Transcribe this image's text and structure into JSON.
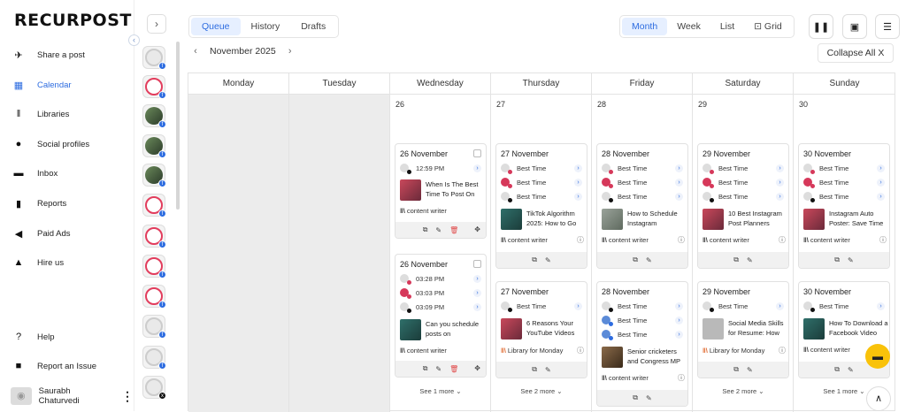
{
  "brand": {
    "logo": "RECURPOST"
  },
  "sidebar": {
    "collapse_glyph": "‹",
    "items": [
      {
        "label": "Share a post",
        "icon": "send-icon",
        "glyph": "✈"
      },
      {
        "label": "Calendar",
        "icon": "calendar-icon",
        "glyph": "▦",
        "active": true
      },
      {
        "label": "Libraries",
        "icon": "libraries-icon",
        "glyph": "‖"
      },
      {
        "label": "Social profiles",
        "icon": "profile-icon",
        "glyph": "●"
      },
      {
        "label": "Inbox",
        "icon": "inbox-icon",
        "glyph": "▬"
      },
      {
        "label": "Reports",
        "icon": "report-icon",
        "glyph": "▮"
      },
      {
        "label": "Paid Ads",
        "icon": "megaphone-icon",
        "glyph": "◀"
      },
      {
        "label": "Hire us",
        "icon": "person-icon",
        "glyph": "▲"
      },
      {
        "label": "Help",
        "icon": "help-icon",
        "glyph": "?"
      },
      {
        "label": "Report an Issue",
        "icon": "flag-icon",
        "glyph": "■"
      }
    ],
    "user": {
      "name": "Saurabh Chaturvedi",
      "more": "⋮"
    }
  },
  "expand_glyph": "›",
  "tabs": [
    "Queue",
    "History",
    "Drafts"
  ],
  "active_tab": "Queue",
  "views": [
    "Month",
    "Week",
    "List",
    "⊡ Grid"
  ],
  "active_view": "Month",
  "toolbar": {
    "pause": "❚❚",
    "calendar": "▣",
    "filters": "☰"
  },
  "month_nav": {
    "label": "November 2025",
    "prev": "‹",
    "next": "›"
  },
  "collapse_all": "Collapse All  X",
  "days": [
    "Monday",
    "Tuesday",
    "Wednesday",
    "Thursday",
    "Friday",
    "Saturday",
    "Sunday"
  ],
  "day_numbers": [
    "26",
    "27",
    "28",
    "29",
    "30"
  ],
  "glyphs": {
    "go": "›",
    "lib": "‖\\",
    "info": "ⓘ",
    "copy": "⧉",
    "edit": "✎",
    "del": "🗑",
    "move": "✥",
    "chat": "▬",
    "up": "∧",
    "chevron": "⌄"
  },
  "cards": {
    "wed1": {
      "date": "26 November",
      "slots": [
        "12:59 PM"
      ],
      "post": "When Is The Best Time To Post On",
      "library": "content writer"
    },
    "wed2": {
      "date": "26 November",
      "slots": [
        "03:28 PM",
        "03:03 PM",
        "03:09 PM"
      ],
      "post": "Can you schedule posts on",
      "library": "content writer",
      "see_more": "See 1 more"
    },
    "thu1": {
      "date": "27 November",
      "slots": [
        "Best Time",
        "Best Time",
        "Best Time"
      ],
      "post": "TikTok Algorithm 2025: How to Go",
      "library": "content writer"
    },
    "thu2": {
      "date": "27 November",
      "slots": [
        "Best Time"
      ],
      "post": "6 Reasons Your YouTube Videos",
      "library": "Library for Monday",
      "see_more": "See 2 more"
    },
    "fri1": {
      "date": "28 November",
      "slots": [
        "Best Time",
        "Best Time",
        "Best Time"
      ],
      "post": "How to Schedule Instagram",
      "library": "content writer"
    },
    "fri2": {
      "date": "28 November",
      "slots": [
        "Best Time",
        "Best Time",
        "Best Time"
      ],
      "post": "Senior cricketers and Congress MP",
      "library": "content writer"
    },
    "sat1": {
      "date": "29 November",
      "slots": [
        "Best Time",
        "Best Time",
        "Best Time"
      ],
      "post": "10 Best Instagram Post Planners",
      "library": "content writer"
    },
    "sat2": {
      "date": "29 November",
      "slots": [
        "Best Time"
      ],
      "post": "Social Media Skills for Resume: How",
      "library": "Library for Monday",
      "see_more": "See 2 more"
    },
    "sun1": {
      "date": "30 November",
      "slots": [
        "Best Time",
        "Best Time",
        "Best Time"
      ],
      "post": "Instagram Auto Poster: Save Time",
      "library": "content writer"
    },
    "sun2": {
      "date": "30 November",
      "slots": [
        "Best Time"
      ],
      "post": "How To Download a Facebook Video",
      "library": "content writer",
      "see_more": "See 1 more"
    }
  }
}
